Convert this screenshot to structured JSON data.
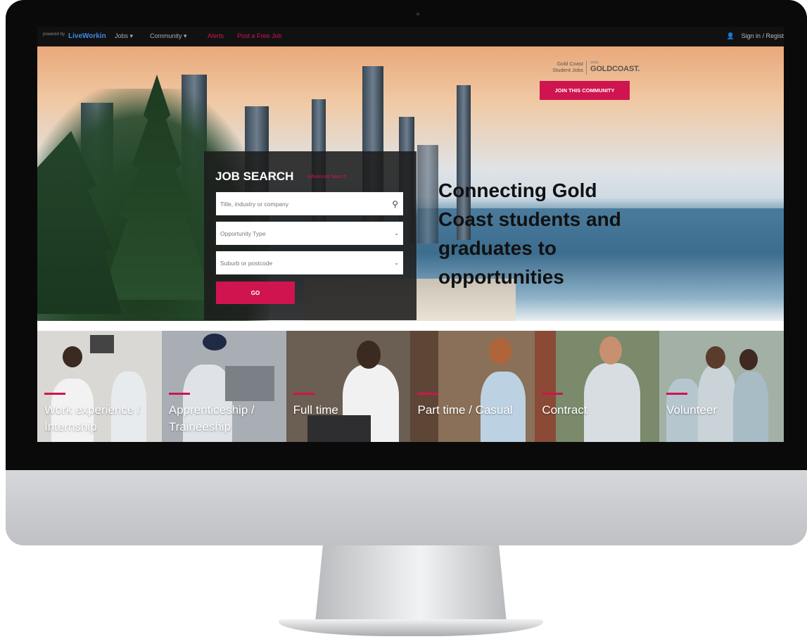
{
  "topbar": {
    "powered_by": "powered by",
    "brand": "LiveWorkin",
    "nav": [
      "Jobs ▾",
      "Community ▾",
      "Alerts",
      "Post a Free Job"
    ],
    "signin": "Sign in / Regist"
  },
  "hero": {
    "community_logo_left": "Gold Coast Student Jobs",
    "community_logo_study": "study",
    "community_logo_right": "GOLDCOAST.",
    "join_button": "JOIN THIS COMMUNITY",
    "tagline": "Connecting Gold Coast students and graduates to opportunities"
  },
  "search": {
    "title": "JOB SEARCH",
    "advanced": "Advanced Search",
    "keyword_placeholder": "Title, industry or company",
    "type_placeholder": "Opportunity Type",
    "location_placeholder": "Suburb or postcode",
    "go": "GO"
  },
  "categories": [
    {
      "label": "Work experience / Internship",
      "bg": "#d9d8d4"
    },
    {
      "label": "Apprenticeship / Traineeship",
      "bg": "#a9aeb4"
    },
    {
      "label": "Full time",
      "bg": "#6b5e52"
    },
    {
      "label": "Part time / Casual",
      "bg": "#8a7058"
    },
    {
      "label": "Contract",
      "bg": "#7a8a6a"
    },
    {
      "label": "Volunteer",
      "bg": "#a3b0a6"
    }
  ],
  "colors": {
    "accent": "#cf1450"
  }
}
